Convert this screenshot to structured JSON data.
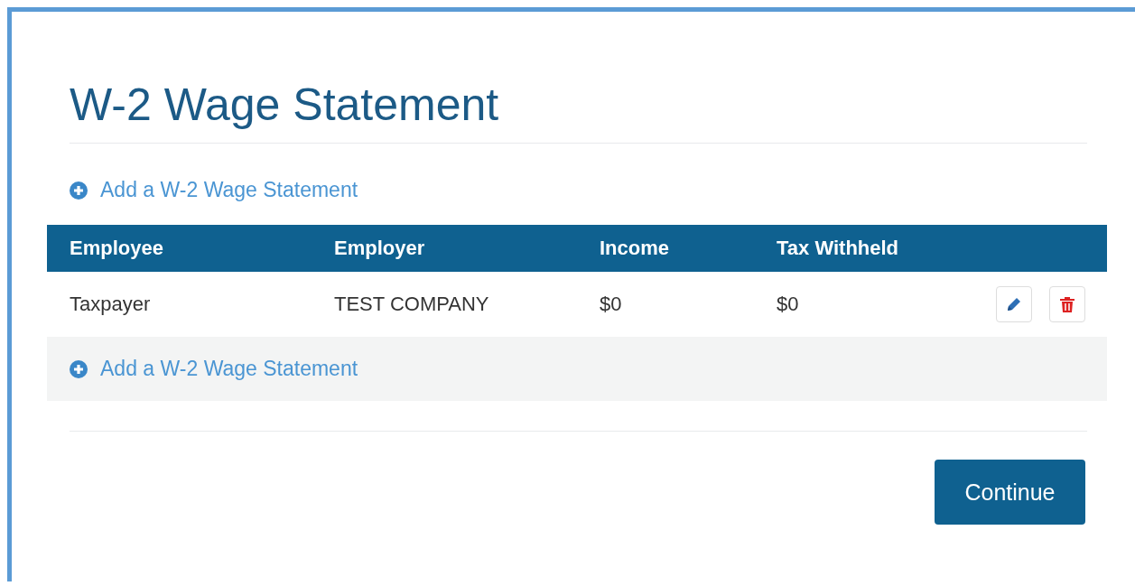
{
  "title": "W-2 Wage Statement",
  "add_link_top": {
    "label": "Add a W-2 Wage Statement"
  },
  "table": {
    "columns": [
      "Employee",
      "Employer",
      "Income",
      "Tax Withheld"
    ],
    "rows": [
      {
        "cells": [
          "Taxpayer",
          "TEST COMPANY",
          "$0",
          "$0"
        ]
      }
    ],
    "footer_link": {
      "label": "Add a W-2 Wage Statement"
    }
  },
  "continue_button": {
    "label": "Continue"
  }
}
